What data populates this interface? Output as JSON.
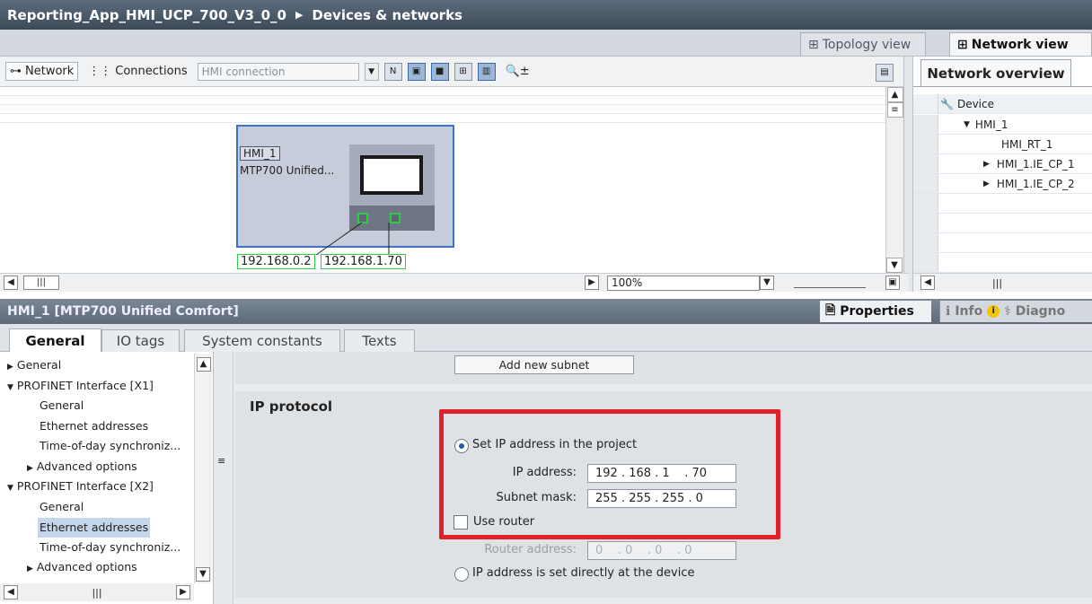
{
  "window": {
    "project": "Reporting_App_HMI_UCP_700_V3_0_0",
    "section": "Devices & networks"
  },
  "views": {
    "topology": "Topology view",
    "network": "Network view"
  },
  "toolbar": {
    "network_label": "Network",
    "connections_label": "Connections",
    "connection_type": "HMI connection"
  },
  "device": {
    "name": "HMI_1",
    "type": "MTP700 Unified...",
    "ip1": "192.168.0.2",
    "ip2": "192.168.1.70"
  },
  "canvas": {
    "zoom": "100%"
  },
  "overview": {
    "tab": "Network overview",
    "column": "Device",
    "rows": [
      "HMI_1",
      "HMI_RT_1",
      "HMI_1.IE_CP_1",
      "HMI_1.IE_CP_2"
    ]
  },
  "inspector": {
    "title": "HMI_1 [MTP700 Unified Comfort]",
    "properties": "Properties",
    "info": "Info",
    "diagnostics": "Diagno",
    "info_badge": "i",
    "tabs": [
      "General",
      "IO tags",
      "System constants",
      "Texts"
    ]
  },
  "tree": {
    "items": [
      "General",
      "PROFINET Interface [X1]",
      "General",
      "Ethernet addresses",
      "Time-of-day synchroniz...",
      "Advanced options",
      "PROFINET Interface [X2]",
      "General",
      "Ethernet addresses",
      "Time-of-day synchroniz...",
      "Advanced options"
    ]
  },
  "ip": {
    "add_subnet": "Add new subnet",
    "section_title": "IP protocol",
    "set_in_project": "Set IP address in the project",
    "ip_label": "IP address:",
    "ip_value": "192 . 168 . 1    . 70",
    "mask_label": "Subnet mask:",
    "mask_value": "255 . 255 . 255 . 0",
    "use_router": "Use router",
    "router_label": "Router address:",
    "router_value": "0    . 0    . 0    . 0",
    "set_directly": "IP address is set directly at the device"
  },
  "colors": {
    "highlight": "#e0212b",
    "port_green": "#2ecc40"
  }
}
